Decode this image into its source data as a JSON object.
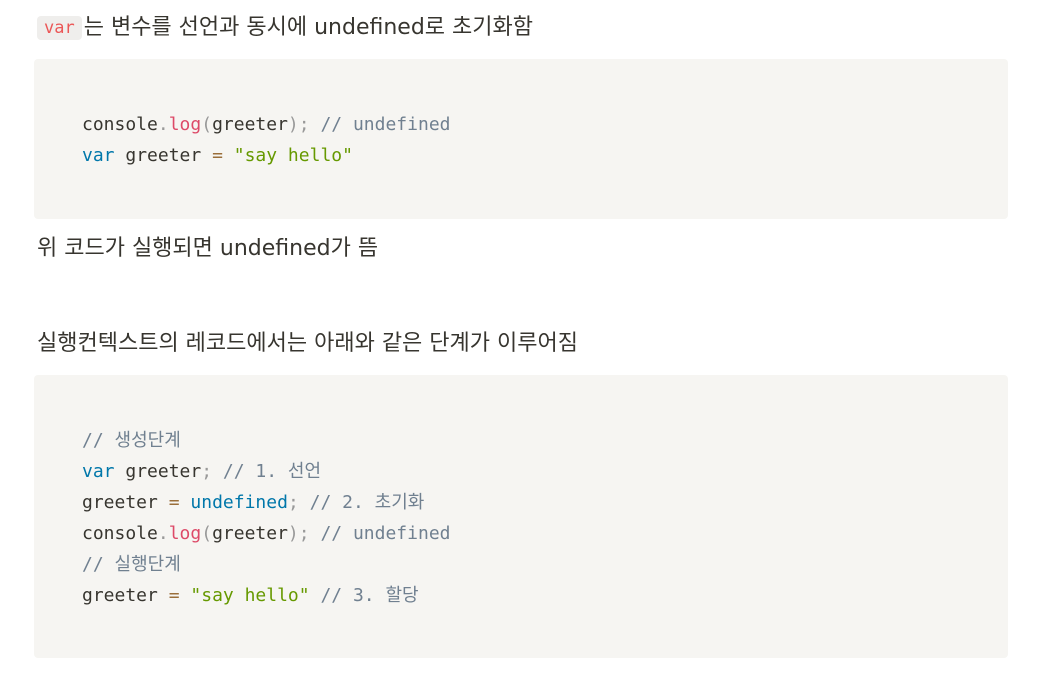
{
  "paragraphs": {
    "p1": {
      "code": "var",
      "text": "는 변수를 선언과 동시에 undefined로  초기화함"
    },
    "p2": {
      "text": "위 코드가 실행되면 undefined가 뜸"
    },
    "p3": {
      "text": "실행컨텍스트의 레코드에서는 아래와 같은 단계가 이루어짐"
    }
  },
  "code_blocks": {
    "block1": {
      "lines": [
        [
          {
            "t": "console",
            "k": "plain"
          },
          {
            "t": ".",
            "k": "punct"
          },
          {
            "t": "log",
            "k": "func"
          },
          {
            "t": "(",
            "k": "punct"
          },
          {
            "t": "greeter",
            "k": "plain"
          },
          {
            "t": ");",
            "k": "punct"
          },
          {
            "t": " ",
            "k": "plain"
          },
          {
            "t": "// undefined",
            "k": "comment"
          }
        ],
        [
          {
            "t": "var",
            "k": "keyword"
          },
          {
            "t": " greeter ",
            "k": "plain"
          },
          {
            "t": "=",
            "k": "op"
          },
          {
            "t": " ",
            "k": "plain"
          },
          {
            "t": "\"say hello\"",
            "k": "string"
          }
        ]
      ]
    },
    "block2": {
      "lines": [
        [
          {
            "t": "// 생성단계",
            "k": "comment"
          }
        ],
        [
          {
            "t": "var",
            "k": "keyword"
          },
          {
            "t": " greeter",
            "k": "plain"
          },
          {
            "t": ";",
            "k": "punct"
          },
          {
            "t": " ",
            "k": "plain"
          },
          {
            "t": "// 1. 선언",
            "k": "comment"
          }
        ],
        [
          {
            "t": "greeter ",
            "k": "plain"
          },
          {
            "t": "=",
            "k": "op"
          },
          {
            "t": " ",
            "k": "plain"
          },
          {
            "t": "undefined",
            "k": "keyword"
          },
          {
            "t": ";",
            "k": "punct"
          },
          {
            "t": " ",
            "k": "plain"
          },
          {
            "t": "// 2. 초기화",
            "k": "comment"
          }
        ],
        [
          {
            "t": "console",
            "k": "plain"
          },
          {
            "t": ".",
            "k": "punct"
          },
          {
            "t": "log",
            "k": "func"
          },
          {
            "t": "(",
            "k": "punct"
          },
          {
            "t": "greeter",
            "k": "plain"
          },
          {
            "t": ");",
            "k": "punct"
          },
          {
            "t": " ",
            "k": "plain"
          },
          {
            "t": "// undefined",
            "k": "comment"
          }
        ],
        [
          {
            "t": "// 실행단계",
            "k": "comment"
          }
        ],
        [
          {
            "t": "greeter ",
            "k": "plain"
          },
          {
            "t": "=",
            "k": "op"
          },
          {
            "t": " ",
            "k": "plain"
          },
          {
            "t": "\"say hello\"",
            "k": "string"
          },
          {
            "t": " ",
            "k": "plain"
          },
          {
            "t": "// 3. 할당",
            "k": "comment"
          }
        ]
      ]
    }
  },
  "colors": {
    "text": "#37352f",
    "code_background": "#f6f5f2",
    "inline_code_text": "#eb5757",
    "keyword": "#0077aa",
    "function": "#dd4a68",
    "comment": "#708090",
    "string": "#669900",
    "operator": "#9a6e3a"
  }
}
